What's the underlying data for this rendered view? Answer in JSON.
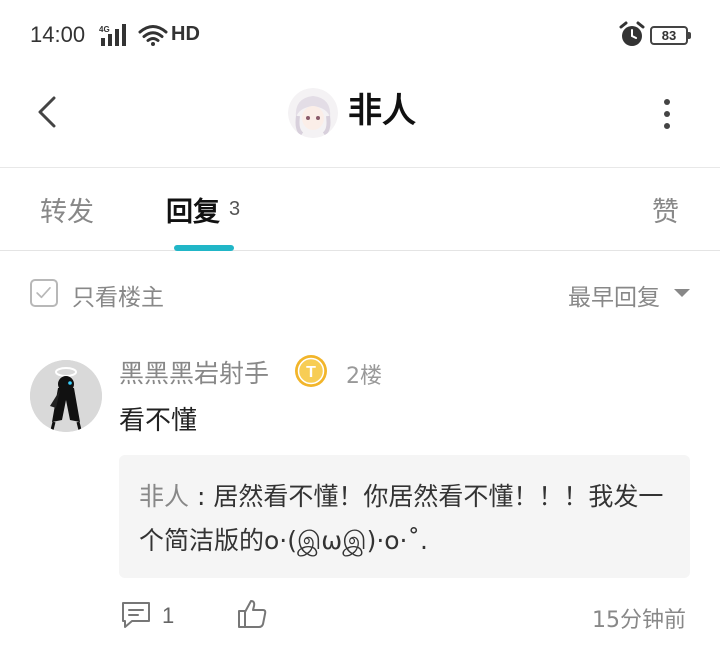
{
  "status_bar": {
    "time": "14:00",
    "network": "4G",
    "hd": "HD",
    "battery": "83"
  },
  "header": {
    "title": "非人"
  },
  "tabs": {
    "forward": "转发",
    "reply": "回复",
    "reply_count": "3",
    "like": "赞"
  },
  "filter": {
    "only_author": "只看楼主",
    "sort": "最早回复"
  },
  "comment": {
    "username": "黑黑黑岩射手",
    "badge": "T",
    "floor": "2楼",
    "text": "看不懂",
    "reply": {
      "author": "非人",
      "separator": " : ",
      "text": "居然看不懂！你居然看不懂！！！我发一个简洁版的o·(இωஇ)·o·˚."
    },
    "reply_count": "1",
    "time": "15分钟前"
  },
  "colors": {
    "accent": "#21b6c7",
    "badge": "#f2b52a"
  }
}
